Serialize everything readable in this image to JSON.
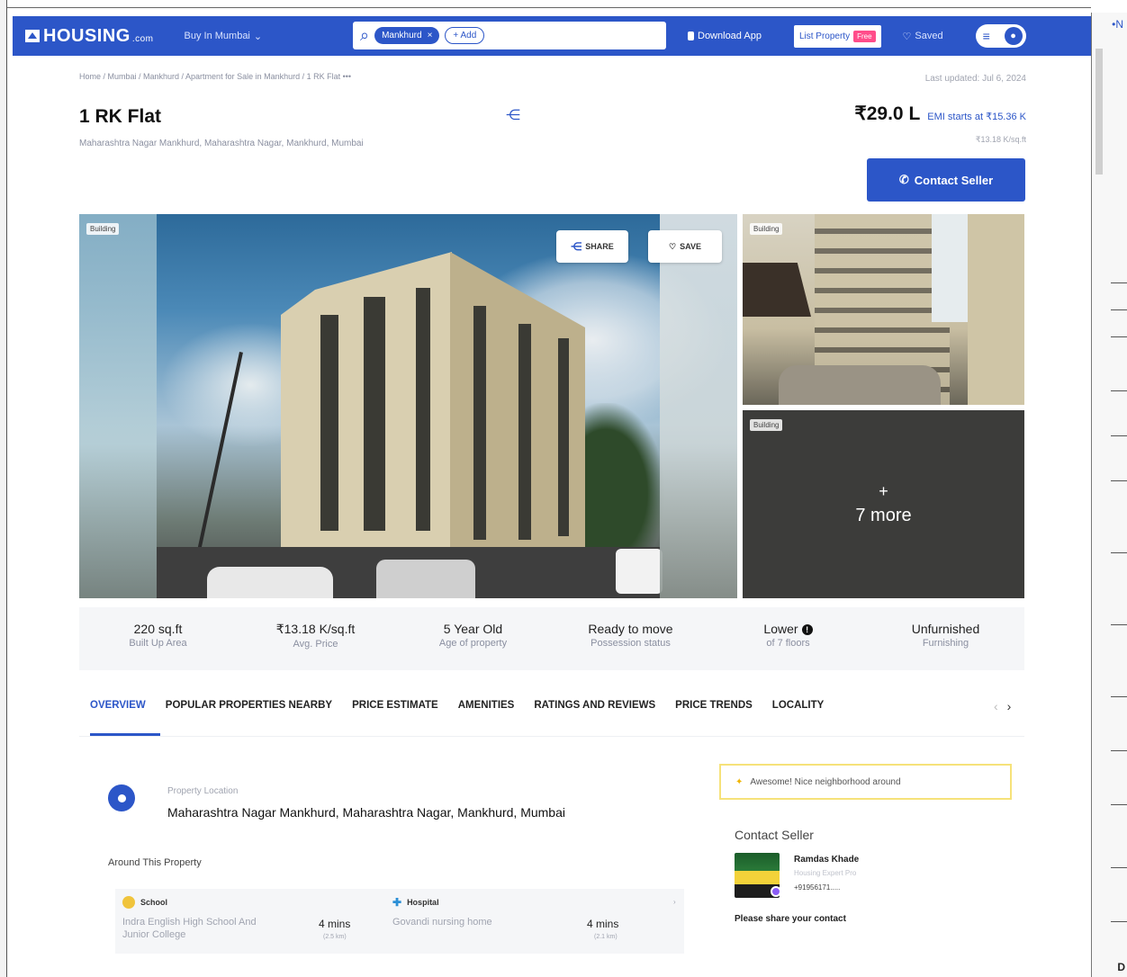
{
  "header": {
    "logo_text": "HOUSING",
    "logo_suffix": ".com",
    "city_selector": "Buy In Mumbai",
    "search_chip": "Mankhurd",
    "search_add": "+ Add",
    "download_app": "Download App",
    "list_property": "List Property",
    "free_badge": "Free",
    "saved": "Saved"
  },
  "breadcrumb": "Home / Mumbai / Mankhurd / Apartment for Sale in Mankhurd / 1 RK Flat  •••",
  "last_updated": "Last updated: Jul 6, 2024",
  "listing": {
    "title": "1 RK Flat",
    "address": "Maharashtra Nagar Mankhurd, Maharashtra Nagar, Mankhurd, Mumbai",
    "price": "₹29.0 L",
    "emi": "EMI starts at ₹15.36 K",
    "price_per_sqft": "₹13.18 K/sq.ft",
    "contact_button": "Contact Seller"
  },
  "gallery": {
    "main_tag": "Building",
    "share_label": "SHARE",
    "save_label": "SAVE",
    "side1_tag": "Building",
    "side2_tag": "Building",
    "more_plus": "+",
    "more_label": "7 more"
  },
  "stats": [
    {
      "value": "220 sq.ft",
      "label": "Built Up Area"
    },
    {
      "value": "₹13.18 K/sq.ft",
      "label": "Avg. Price"
    },
    {
      "value": "5 Year Old",
      "label": "Age of property"
    },
    {
      "value": "Ready to move",
      "label": "Possession status"
    },
    {
      "value": "Lower",
      "label": "of 7 floors"
    },
    {
      "value": "Unfurnished",
      "label": "Furnishing"
    }
  ],
  "tabs": [
    "OVERVIEW",
    "POPULAR PROPERTIES NEARBY",
    "PRICE ESTIMATE",
    "AMENITIES",
    "RATINGS AND REVIEWS",
    "PRICE TRENDS",
    "LOCALITY"
  ],
  "location": {
    "label": "Property Location",
    "address": "Maharashtra Nagar Mankhurd, Maharashtra Nagar, Mankhurd, Mumbai"
  },
  "around": {
    "title": "Around This Property",
    "items": [
      {
        "category": "School",
        "name": "Indra English High School And Junior College",
        "time": "4 mins",
        "distance": "(2.5 km)"
      },
      {
        "category": "Hospital",
        "name": "Govandi nursing home",
        "time": "4 mins",
        "distance": "(2.1 km)"
      }
    ]
  },
  "sidebar": {
    "neighborhood": "Awesome! Nice neighborhood around",
    "contact_title": "Contact Seller",
    "agent_name": "Ramdas Khade",
    "agent_sub": "Housing Expert Pro",
    "agent_phone": "+91956171.....",
    "share_contact": "Please share your contact"
  },
  "colors": {
    "brand": "#2c56c8",
    "free_badge": "#ff4d8a",
    "neighborhood_border": "#f6e27a"
  }
}
